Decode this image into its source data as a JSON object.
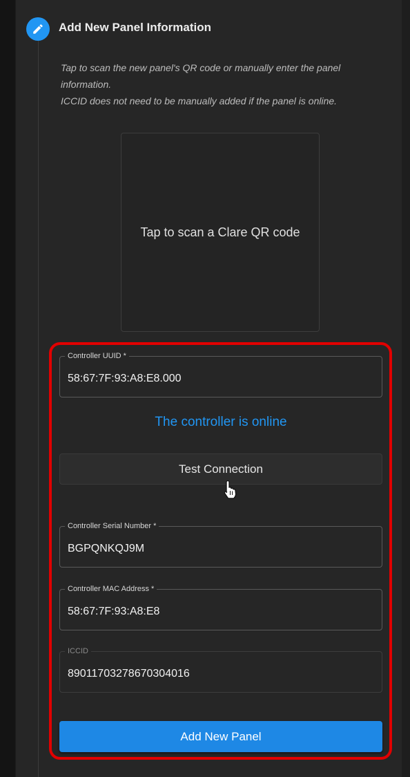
{
  "step": {
    "title": "Add New Panel Information",
    "icon": "pencil-icon",
    "instructions": [
      "Tap to scan the new panel's QR code or manually enter the panel",
      "information.",
      "ICCID does not need to be manually added if the panel is online."
    ]
  },
  "qr": {
    "label": "Tap to scan a Clare QR code"
  },
  "fields": {
    "uuid": {
      "label": "Controller UUID *",
      "value": "58:67:7F:93:A8:E8.000"
    },
    "serial": {
      "label": "Controller Serial Number *",
      "value": "BGPQNKQJ9M"
    },
    "mac": {
      "label": "Controller MAC Address *",
      "value": "58:67:7F:93:A8:E8"
    },
    "iccid": {
      "label": "ICCID",
      "value": "89011703278670304016"
    }
  },
  "status": {
    "text": "The controller is online"
  },
  "buttons": {
    "test_connection": "Test Connection",
    "add_panel": "Add New Panel"
  },
  "colors": {
    "accent": "#2196f3",
    "primary_button": "#1e88e5",
    "highlight_border": "#e10000",
    "panel_background": "#262626"
  }
}
